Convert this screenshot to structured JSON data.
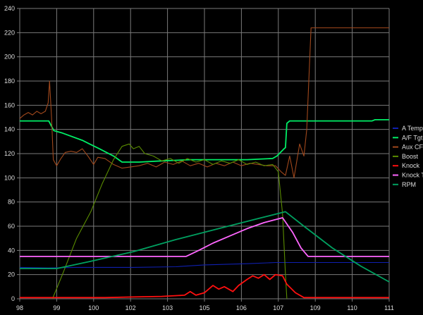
{
  "chart_data": {
    "type": "line",
    "title": "",
    "xlabel": "",
    "ylabel": "",
    "x_tick_labels": [
      "98",
      "99",
      "100",
      "102",
      "103",
      "105",
      "106",
      "107",
      "109",
      "110",
      "111"
    ],
    "x_tick_positions": [
      0,
      1,
      2,
      3,
      4,
      5,
      6,
      7,
      8,
      9,
      10,
      11,
      12,
      13
    ],
    "x_tick_labels_full": [
      "98",
      "99",
      "100",
      "102",
      "103",
      "105",
      "106",
      "107",
      "109",
      "110",
      "111"
    ],
    "x_ticks": [
      {
        "pos": 0,
        "label": "98"
      },
      {
        "pos": 1,
        "label": "99"
      },
      {
        "pos": 2,
        "label": "100"
      },
      {
        "pos": 3,
        "label": "102"
      },
      {
        "pos": 4,
        "label": "103"
      },
      {
        "pos": 5,
        "label": "105"
      },
      {
        "pos": 6,
        "label": "106"
      },
      {
        "pos": 7,
        "label": "107"
      },
      {
        "pos": 8,
        "label": "109"
      },
      {
        "pos": 9,
        "label": "110"
      },
      {
        "pos": 10,
        "label": "111"
      }
    ],
    "xlim": [
      0,
      13
    ],
    "ylim": [
      0,
      240
    ],
    "y_ticks": [
      0,
      20,
      40,
      60,
      80,
      100,
      120,
      140,
      160,
      180,
      200,
      220,
      240
    ],
    "grid": true,
    "legend_position": "right",
    "series": [
      {
        "name": "A Temp",
        "color": "#1020b0",
        "points": [
          [
            0,
            26
          ],
          [
            1,
            25.5
          ],
          [
            2,
            26
          ],
          [
            4,
            26
          ],
          [
            5.5,
            26.5
          ],
          [
            6.5,
            28
          ],
          [
            8,
            29
          ],
          [
            9,
            30
          ],
          [
            10,
            30
          ],
          [
            13,
            30
          ]
        ]
      },
      {
        "name": "A/F Tgt",
        "color": "#00ee66",
        "points": [
          [
            0,
            147
          ],
          [
            1.02,
            147
          ],
          [
            1.2,
            139
          ],
          [
            1.5,
            137
          ],
          [
            2.2,
            131
          ],
          [
            2.8,
            124
          ],
          [
            3.3,
            118
          ],
          [
            3.6,
            113
          ],
          [
            4.2,
            113
          ],
          [
            5,
            114
          ],
          [
            6,
            115
          ],
          [
            7,
            115
          ],
          [
            8,
            115
          ],
          [
            8.9,
            116
          ],
          [
            9.05,
            118
          ],
          [
            9.3,
            124
          ],
          [
            9.35,
            125
          ],
          [
            9.4,
            145
          ],
          [
            9.5,
            147
          ],
          [
            12.4,
            147
          ],
          [
            12.5,
            148
          ],
          [
            13,
            148
          ]
        ]
      },
      {
        "name": "Aux CF",
        "color": "#a0481c",
        "points": [
          [
            0,
            149
          ],
          [
            0.15,
            152
          ],
          [
            0.3,
            154
          ],
          [
            0.45,
            152
          ],
          [
            0.6,
            155
          ],
          [
            0.75,
            153
          ],
          [
            0.9,
            155
          ],
          [
            1.0,
            162
          ],
          [
            1.05,
            180
          ],
          [
            1.12,
            150
          ],
          [
            1.18,
            115
          ],
          [
            1.3,
            110
          ],
          [
            1.45,
            116
          ],
          [
            1.6,
            121
          ],
          [
            1.8,
            122
          ],
          [
            2.0,
            121
          ],
          [
            2.2,
            124
          ],
          [
            2.4,
            118
          ],
          [
            2.6,
            111
          ],
          [
            2.75,
            117
          ],
          [
            3.0,
            116
          ],
          [
            3.3,
            111
          ],
          [
            3.6,
            108
          ],
          [
            3.9,
            109
          ],
          [
            4.2,
            110
          ],
          [
            4.5,
            112
          ],
          [
            4.8,
            109
          ],
          [
            5.1,
            113
          ],
          [
            5.4,
            111
          ],
          [
            5.7,
            114
          ],
          [
            6.0,
            110
          ],
          [
            6.3,
            112
          ],
          [
            6.6,
            109
          ],
          [
            6.9,
            112
          ],
          [
            7.2,
            110
          ],
          [
            7.5,
            113
          ],
          [
            7.8,
            110
          ],
          [
            8.1,
            112
          ],
          [
            8.4,
            111
          ],
          [
            8.7,
            110
          ],
          [
            9.0,
            110
          ],
          [
            9.2,
            105
          ],
          [
            9.35,
            102
          ],
          [
            9.5,
            118
          ],
          [
            9.65,
            100
          ],
          [
            9.85,
            128
          ],
          [
            10.0,
            118
          ],
          [
            10.1,
            140
          ],
          [
            10.25,
            224
          ],
          [
            13,
            224
          ]
        ]
      },
      {
        "name": "Boost",
        "color": "#5a8c00",
        "points": [
          [
            1.15,
            0
          ],
          [
            1.5,
            20
          ],
          [
            2.0,
            50
          ],
          [
            2.5,
            72
          ],
          [
            2.9,
            95
          ],
          [
            3.3,
            115
          ],
          [
            3.6,
            126
          ],
          [
            3.85,
            128
          ],
          [
            4.0,
            124
          ],
          [
            4.2,
            126
          ],
          [
            4.4,
            120
          ],
          [
            4.7,
            118
          ],
          [
            5.0,
            114
          ],
          [
            5.3,
            116
          ],
          [
            5.6,
            112
          ],
          [
            5.9,
            116
          ],
          [
            6.2,
            113
          ],
          [
            6.5,
            115
          ],
          [
            6.8,
            111
          ],
          [
            7.1,
            114
          ],
          [
            7.4,
            112
          ],
          [
            7.7,
            115
          ],
          [
            8.0,
            111
          ],
          [
            8.3,
            113
          ],
          [
            8.6,
            110
          ],
          [
            8.9,
            111
          ],
          [
            9.1,
            105
          ],
          [
            9.25,
            70
          ],
          [
            9.35,
            20
          ],
          [
            9.4,
            0
          ]
        ]
      },
      {
        "name": "Knock",
        "color": "#ff1010",
        "points": [
          [
            0,
            1
          ],
          [
            3,
            1
          ],
          [
            4,
            1.5
          ],
          [
            5,
            2
          ],
          [
            5.8,
            3
          ],
          [
            6.0,
            6
          ],
          [
            6.2,
            3
          ],
          [
            6.5,
            5
          ],
          [
            6.8,
            11
          ],
          [
            7.0,
            8
          ],
          [
            7.2,
            10
          ],
          [
            7.5,
            6
          ],
          [
            7.7,
            11
          ],
          [
            8.0,
            16
          ],
          [
            8.2,
            19
          ],
          [
            8.4,
            17
          ],
          [
            8.6,
            20
          ],
          [
            8.8,
            16
          ],
          [
            9.0,
            20
          ],
          [
            9.25,
            19
          ],
          [
            9.4,
            12
          ],
          [
            9.7,
            5
          ],
          [
            10.0,
            1
          ],
          [
            13,
            1
          ]
        ]
      },
      {
        "name": "Knock T",
        "color": "#ff66ff",
        "points": [
          [
            0,
            35
          ],
          [
            5.85,
            35
          ],
          [
            6.3,
            40
          ],
          [
            6.8,
            46
          ],
          [
            7.4,
            52
          ],
          [
            8.0,
            58
          ],
          [
            8.6,
            63
          ],
          [
            9.25,
            67
          ],
          [
            9.6,
            55
          ],
          [
            9.9,
            42
          ],
          [
            10.15,
            35
          ],
          [
            13,
            35
          ]
        ]
      },
      {
        "name": "RPM",
        "color": "#00a060",
        "points": [
          [
            0,
            25
          ],
          [
            1.3,
            25
          ],
          [
            2.5,
            31
          ],
          [
            4,
            39
          ],
          [
            5.5,
            49
          ],
          [
            7,
            58
          ],
          [
            8.5,
            67
          ],
          [
            9.35,
            72
          ],
          [
            10,
            60
          ],
          [
            11,
            42
          ],
          [
            12,
            27
          ],
          [
            13,
            14
          ]
        ]
      }
    ]
  }
}
